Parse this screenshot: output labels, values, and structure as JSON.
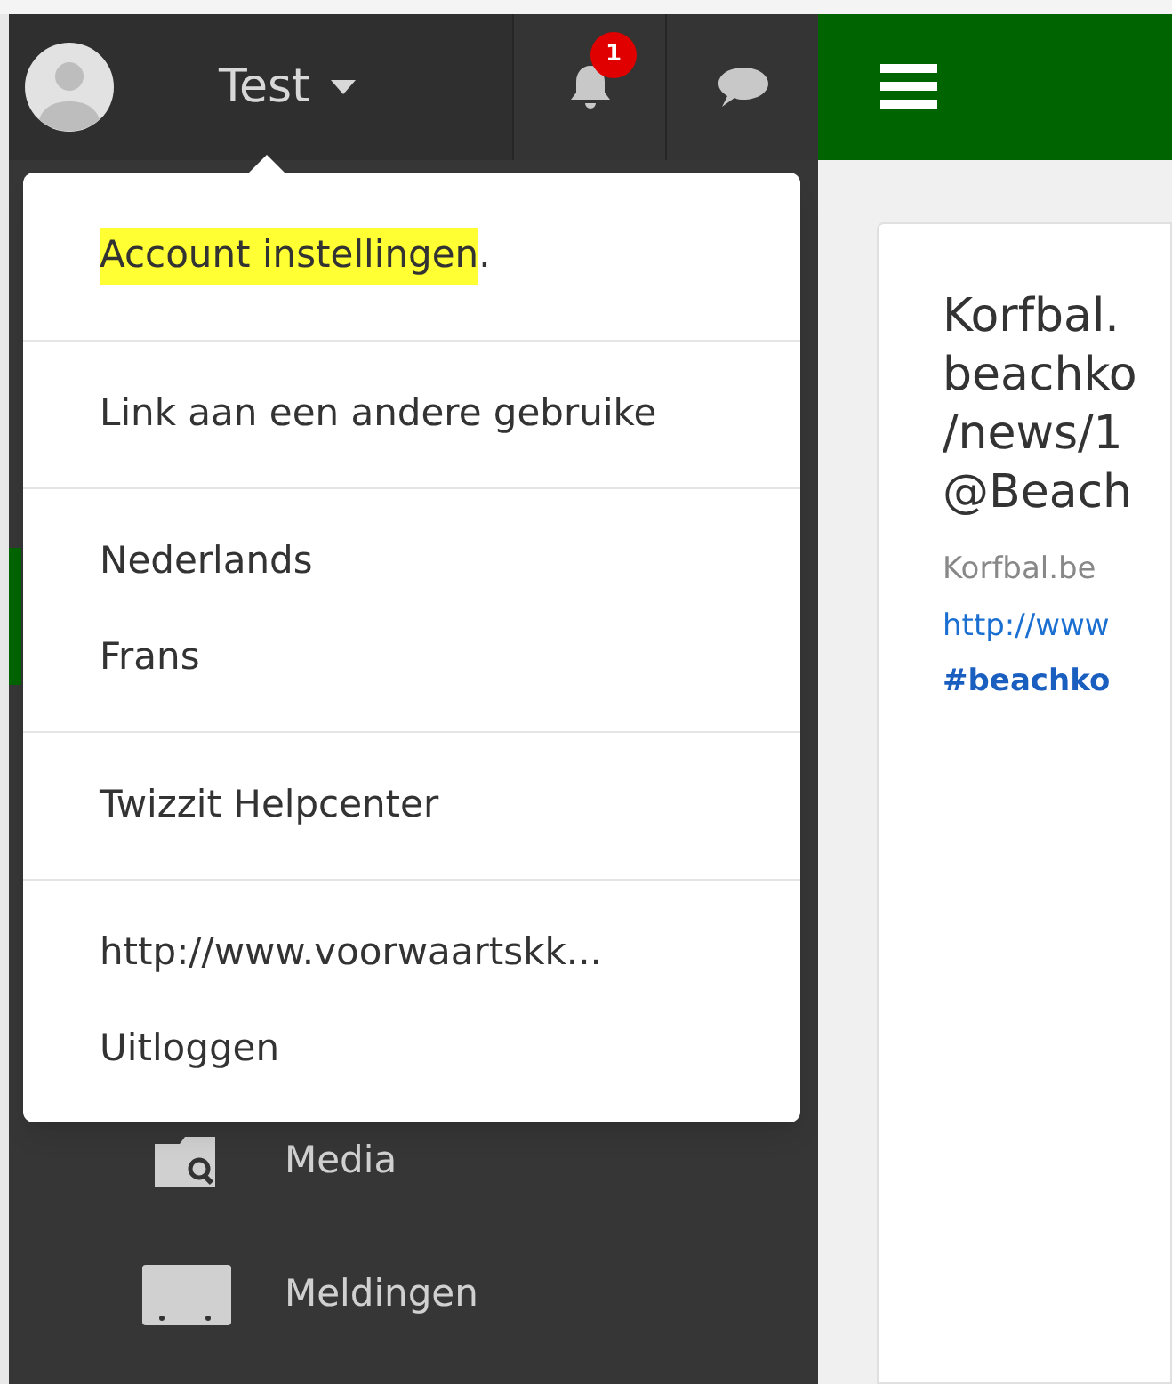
{
  "topbar": {
    "user_name": "Test",
    "notification_count": "1"
  },
  "dropdown": {
    "groups": [
      [
        {
          "label": "Account instellingen",
          "highlighted": true,
          "suffix": "."
        }
      ],
      [
        {
          "label": "Link aan een andere gebruike",
          "highlighted": false
        }
      ],
      [
        {
          "label": "Nederlands",
          "highlighted": false
        },
        {
          "label": "Frans",
          "highlighted": false
        }
      ],
      [
        {
          "label": "Twizzit Helpcenter",
          "highlighted": false
        }
      ],
      [
        {
          "label": "http://www.voorwaartskk...",
          "highlighted": false
        },
        {
          "label": "Uitloggen",
          "highlighted": false
        }
      ]
    ]
  },
  "sidebar": {
    "items": [
      {
        "kind": "media",
        "label": "Media",
        "selected": false
      },
      {
        "kind": "notifications",
        "label": "Meldingen",
        "selected": false
      }
    ]
  },
  "post": {
    "title_lines": [
      "Korfbal.",
      "beachko",
      "/news/1",
      "@Beach"
    ],
    "source": "Korfbal.be",
    "link": "http://www",
    "hashtag": "#beachko"
  }
}
